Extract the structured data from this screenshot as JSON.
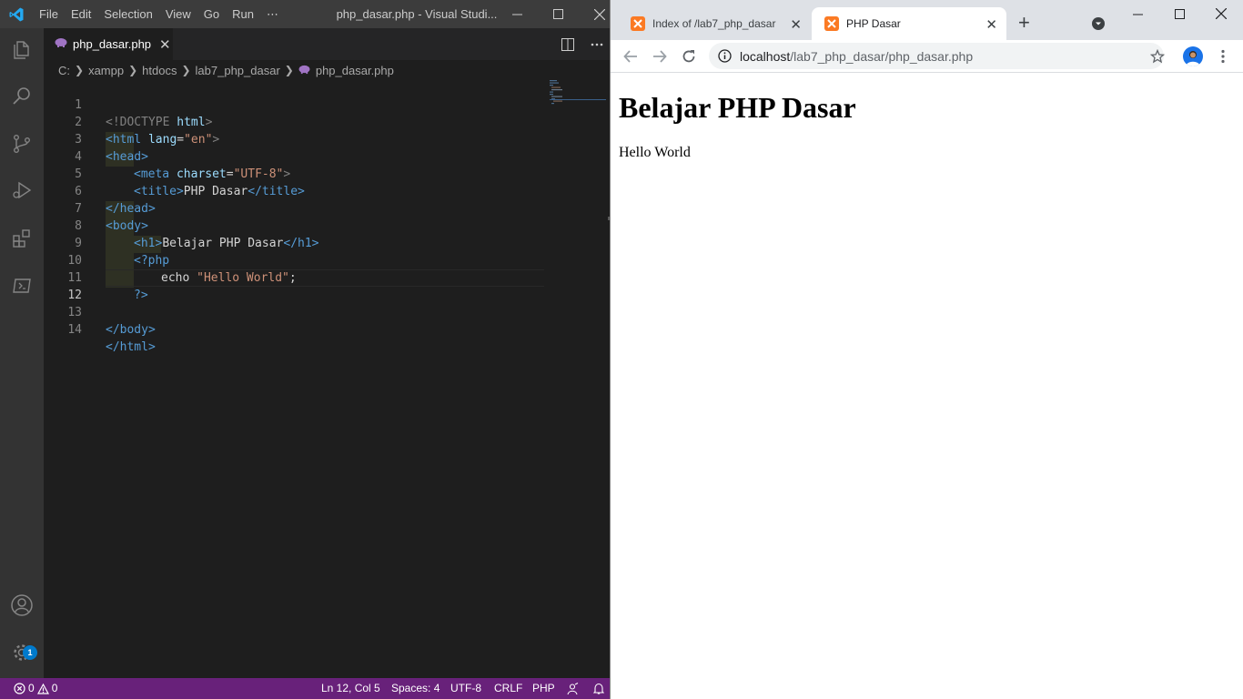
{
  "vscode": {
    "menu": [
      "File",
      "Edit",
      "Selection",
      "View",
      "Go",
      "Run",
      "⋯"
    ],
    "window_title": "php_dasar.php - Visual Studi...",
    "tab": {
      "label": "php_dasar.php",
      "close": "✕"
    },
    "breadcrumb": [
      "C:",
      "xampp",
      "htdocs",
      "lab7_php_dasar",
      "php_dasar.php"
    ],
    "line_numbers": [
      "1",
      "2",
      "3",
      "4",
      "5",
      "6",
      "7",
      "8",
      "9",
      "10",
      "11",
      "12",
      "13",
      "14"
    ],
    "code": {
      "l1": {
        "a": "<!DOCTYPE",
        "b": " html",
        "c": ">"
      },
      "l2": {
        "a": "<html",
        "b": " lang",
        "c": "=",
        "d": "\"en\"",
        "e": ">"
      },
      "l3": {
        "a": "<head>"
      },
      "l4": {
        "a": "<meta",
        "b": " charset",
        "c": "=",
        "d": "\"UTF-8\"",
        "e": ">"
      },
      "l5": {
        "a": "<title>",
        "b": "PHP Dasar",
        "c": "</title>"
      },
      "l6": {
        "a": "</head>"
      },
      "l7": {
        "a": "<body>"
      },
      "l8": {
        "a": "<h1>",
        "b": "Belajar PHP Dasar",
        "c": "</h1>"
      },
      "l9": {
        "a": "<?php"
      },
      "l10": {
        "a": "echo ",
        "b": "\"Hello World\"",
        "c": ";"
      },
      "l11": {
        "a": "?>"
      },
      "l13": {
        "a": "</body>"
      },
      "l14": {
        "a": "</html>"
      }
    },
    "status": {
      "errors": "0",
      "warnings": "0",
      "position": "Ln 12, Col 5",
      "spaces": "Spaces: 4",
      "encoding": "UTF-8",
      "eol": "CRLF",
      "language": "PHP"
    },
    "settings_badge": "1",
    "colors": {
      "statusbar": "#68217a",
      "accent": "#007acc"
    }
  },
  "chrome": {
    "tabs": [
      {
        "title": "Index of /lab7_php_dasar",
        "close": "✕"
      },
      {
        "title": "PHP Dasar",
        "close": "✕"
      }
    ],
    "new_tab": "+",
    "url_host": "localhost",
    "url_path": "/lab7_php_dasar/php_dasar.php",
    "page": {
      "heading": "Belajar PHP Dasar",
      "text": "Hello World"
    }
  }
}
